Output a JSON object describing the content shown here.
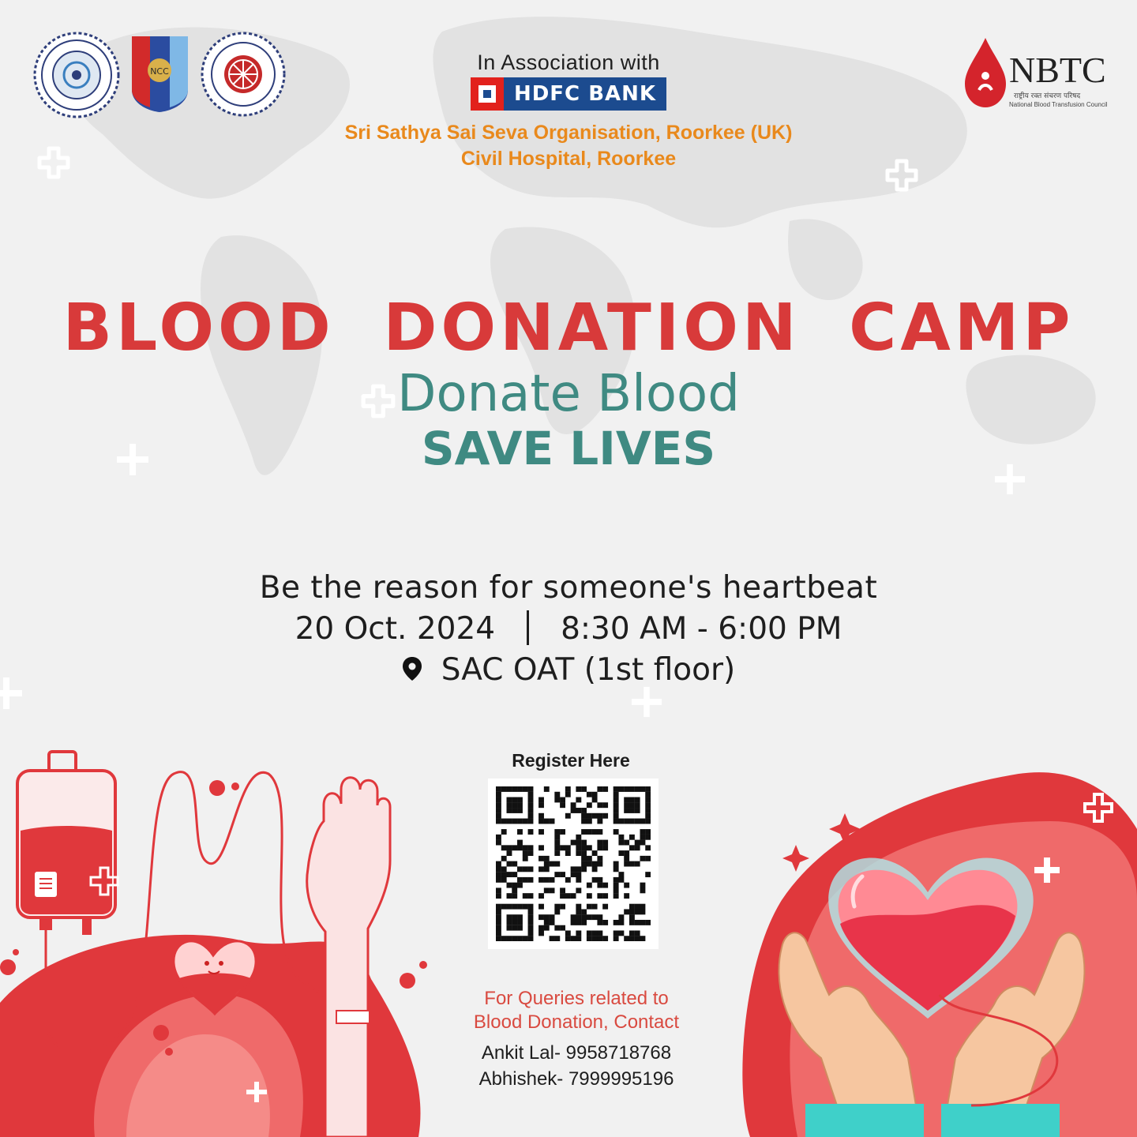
{
  "association": {
    "label": "In Association with",
    "sponsor": "HDFC BANK",
    "organisations": [
      "Sri Sathya Sai Seva Organisation, Roorkee (UK)",
      "Civil Hospital, Roorkee"
    ]
  },
  "logos": {
    "ncc_text": "NCC",
    "nbtc": "NBTC",
    "nbtc_hindi": "राष्ट्रीय रक्त संचरण परिषद",
    "nbtc_full": "National Blood Transfusion Council"
  },
  "headline": {
    "title": "BLOOD  DONATION  CAMP",
    "subtitle": "Donate Blood",
    "subtitle2": "SAVE LIVES"
  },
  "event": {
    "tagline": "Be the reason for someone's heartbeat",
    "date": "20 Oct. 2024",
    "time": "8:30 AM - 6:00 PM",
    "venue": "SAC OAT (1st floor)"
  },
  "register": {
    "label": "Register Here"
  },
  "contact": {
    "line1": "For Queries related to",
    "line2": "Blood Donation, Contact",
    "people": [
      "Ankit Lal- 9958718768",
      "Abhishek- 7999995196"
    ]
  },
  "colors": {
    "primary_red": "#d83a3a",
    "teal": "#3f8a82",
    "orange": "#e9891c",
    "hdfc_blue": "#1c4b8f"
  }
}
